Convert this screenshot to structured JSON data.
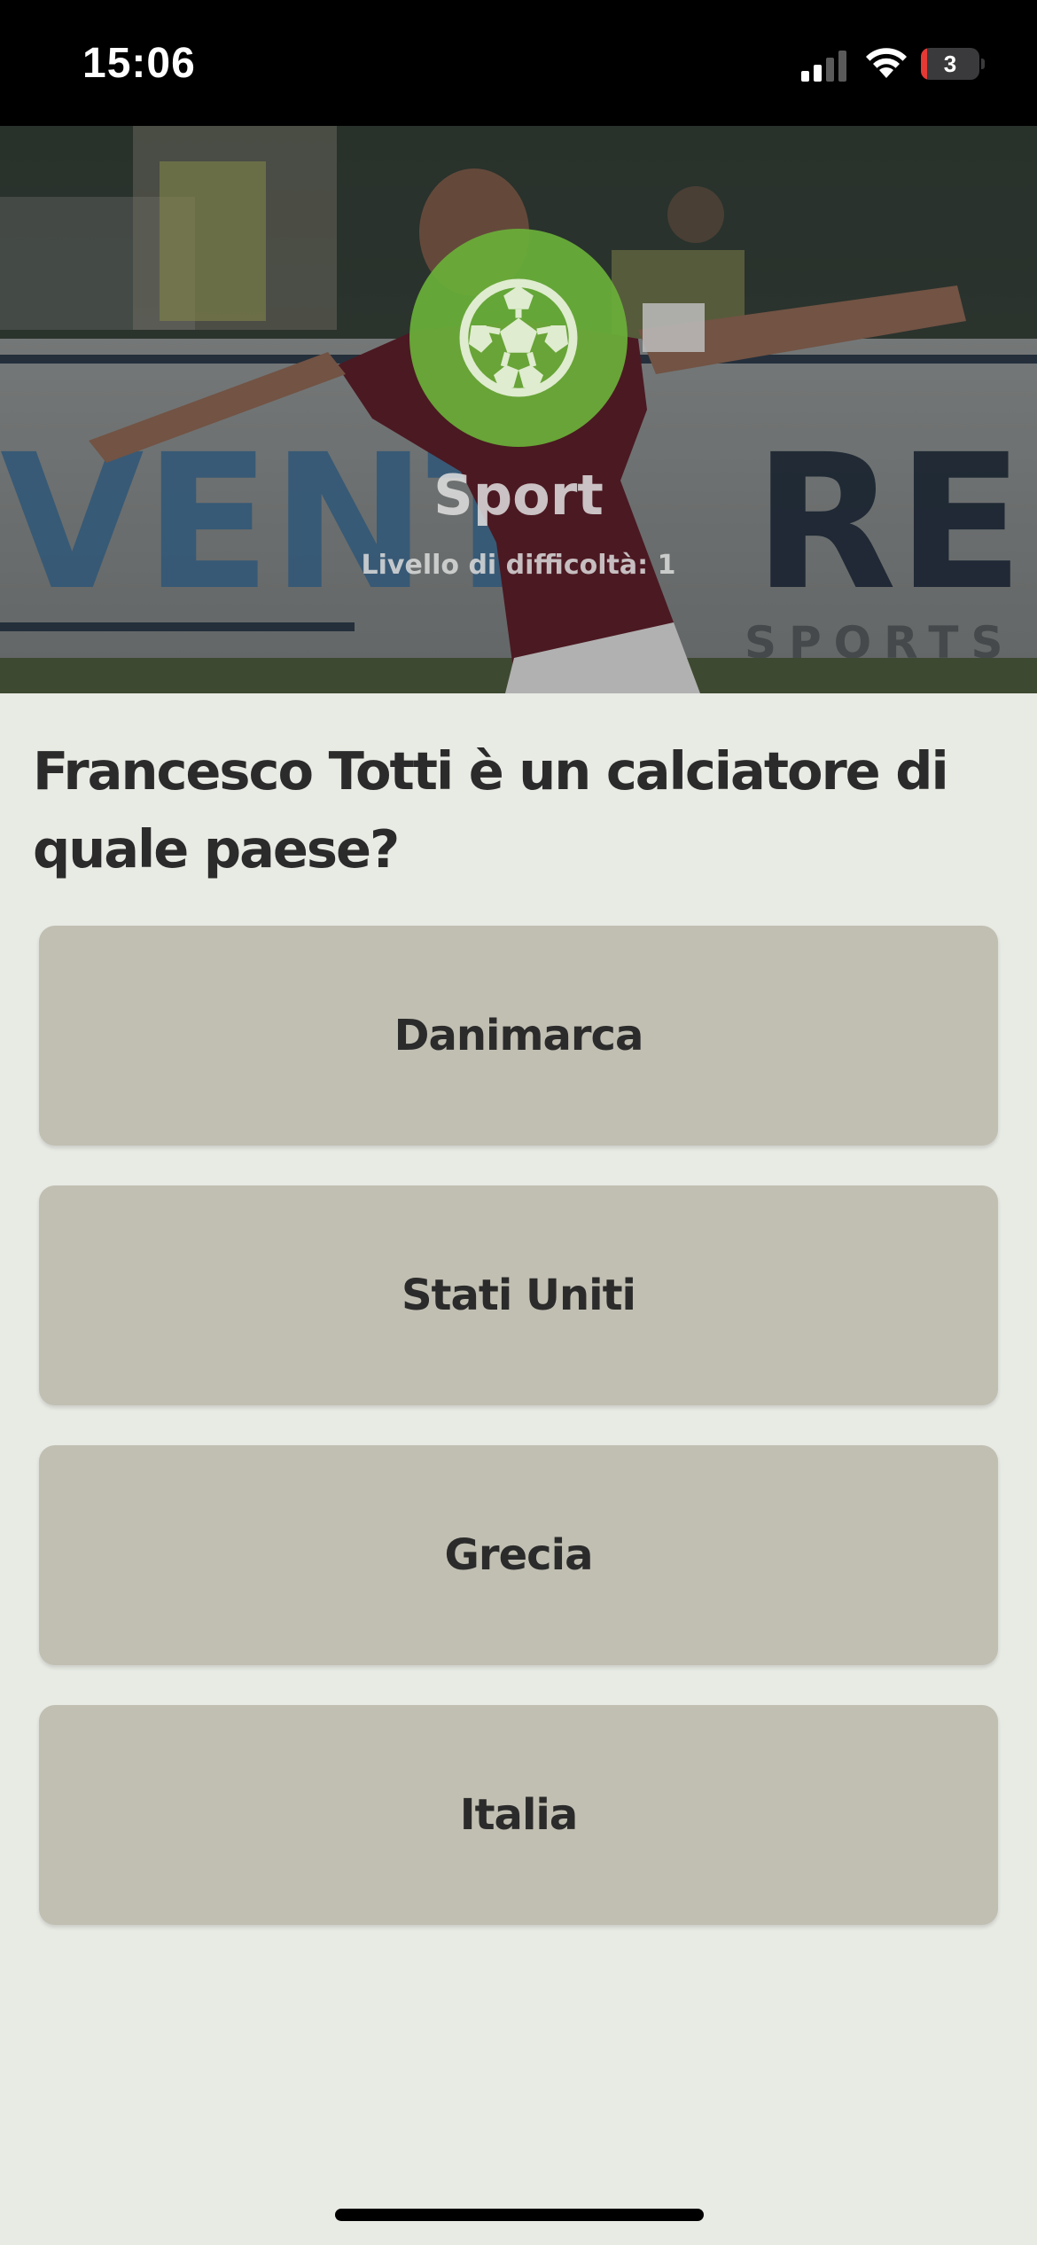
{
  "status_bar": {
    "time": "15:06",
    "battery_level": "3",
    "battery_fraction": 0.1
  },
  "hero": {
    "category_icon": "soccer-ball-icon",
    "category": "Sport",
    "difficulty": "Livello di difficoltà: 1",
    "badge_color": "#6ab03a"
  },
  "quiz": {
    "question": "Francesco Totti è un calciatore di quale paese?",
    "answers": [
      {
        "label": "Danimarca"
      },
      {
        "label": "Stati Uniti"
      },
      {
        "label": "Grecia"
      },
      {
        "label": "Italia"
      }
    ]
  },
  "colors": {
    "background": "#e8eae4",
    "answer_button": "#c1bfb2",
    "text": "#2b2b2b"
  }
}
